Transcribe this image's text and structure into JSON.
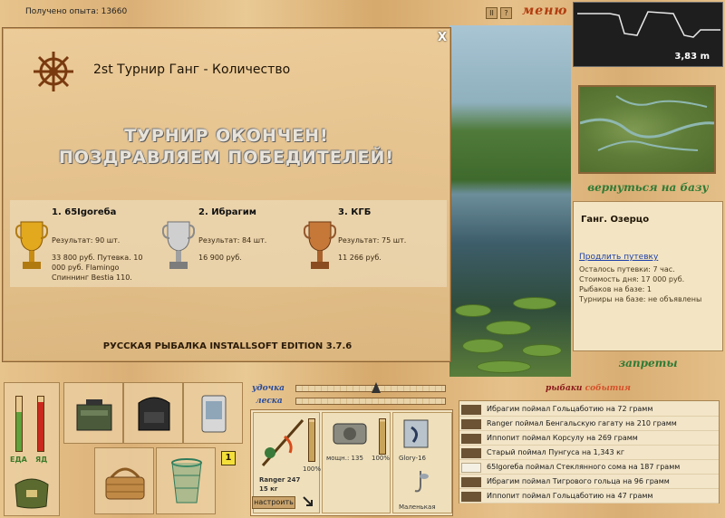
{
  "topbar": {
    "experience": "Получено опыта: 13660",
    "icon_pause": "II",
    "icon_help": "?",
    "menu": "меню"
  },
  "dialog": {
    "close": "X",
    "title": "2st Турнир Ганг - Количество",
    "headline1": "ТУРНИР ОКОНЧЕН!",
    "headline2": "ПОЗДРАВЛЯЕМ ПОБЕДИТЕЛЕЙ!",
    "winners": [
      {
        "name": "1. 65Igoreба",
        "result": "Результат: 90 шт.",
        "prize": "33 800 руб. Путевка. 10 000 руб. Flamingo Спиннинг Bestia 110.",
        "cup": "gold"
      },
      {
        "name": "2. Ибрагим",
        "result": "Результат: 84 шт.",
        "prize": "16 900 руб.",
        "cup": "silver"
      },
      {
        "name": "3. КГБ",
        "result": "Результат: 75 шт.",
        "prize": "11 266 руб.",
        "cup": "bronze"
      }
    ],
    "edition": "РУССКАЯ РЫБАЛКА INSTALLSOFT EDITION 3.7.6"
  },
  "depth": {
    "value": "3,83 m"
  },
  "right": {
    "back_btn": "вернуться на базу",
    "place": "Ганг. Озерцо",
    "extend": "Продлить путевку",
    "lines": [
      "Осталось путевки: 7 час.",
      "Стоимость дня: 17 000 руб.",
      "Рыбаков на базе: 1",
      "Турниры на базе: не объявлены"
    ],
    "bans": "запреты"
  },
  "bottom": {
    "food_label": "ЕДА",
    "drink_label": "ЯД",
    "badge": "1",
    "rod_label": "удочка",
    "line_label": "леска",
    "rod_name": "Ranger 247",
    "rod_weight": "15 кг",
    "rod_pct": "100%",
    "reel_power": "мощн.: 135",
    "reel_pct": "100%",
    "lure_name": "Glory-16",
    "hook_name": "Маленькая",
    "set_btn": "настроить"
  },
  "feed": {
    "header_a": "рыбаки",
    "header_b": "события",
    "items": [
      {
        "text": "Ибрагим поймал Гольцаботию на 72 грамм",
        "icon": "fish-dark-icon"
      },
      {
        "text": "Ranger поймал Бенгальскую гагату на 210 грамм",
        "icon": "fish-dark-icon"
      },
      {
        "text": "Иппопит поймал Корсулу на 269 грамм",
        "icon": "fish-dark-icon"
      },
      {
        "text": "Старый поймал Пунгуса на 1,343 кг",
        "icon": "fish-dark-icon"
      },
      {
        "text": "65Igoreба поймал Стеклянного сома на 187 грамм",
        "icon": "fish-white-icon"
      },
      {
        "text": "Ибрагим поймал Тигрового гольца на 96 грамм",
        "icon": "fish-dark-icon"
      },
      {
        "text": "Иппопит поймал Гольцаботию на 47 грамм",
        "icon": "fish-dark-icon"
      }
    ]
  },
  "colors": {
    "accent_menu": "#b13d10",
    "accent_green": "#2f7a35",
    "link": "#1d3fa8"
  }
}
